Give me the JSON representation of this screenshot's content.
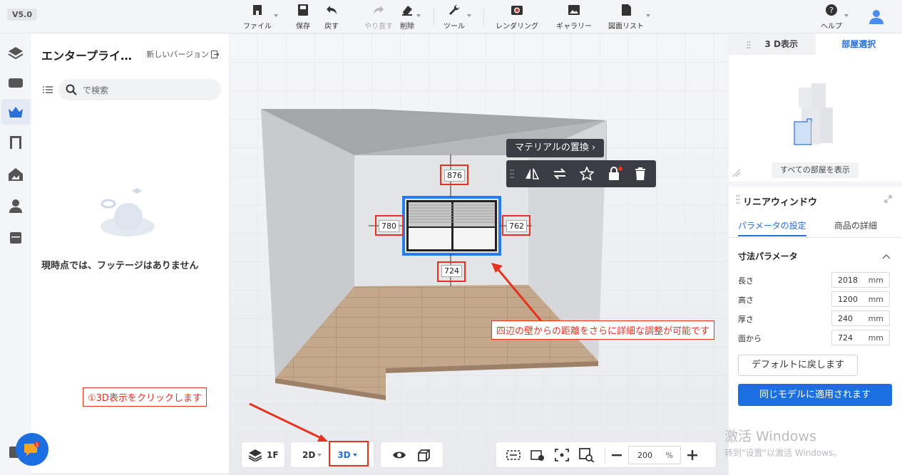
{
  "app": {
    "version": "V5.0"
  },
  "toolbar": {
    "file": "ファイル",
    "save": "保存",
    "undo": "戻す",
    "redo": "やり直す",
    "delete": "削除",
    "tools": "ツール",
    "rendering": "レンダリング",
    "gallery": "ギャラリー",
    "drawing_list": "図面リスト",
    "help": "ヘルプ"
  },
  "left_panel": {
    "title": "エンタープライ…",
    "new_version": "新しいバージョン",
    "search_placeholder": "で検索",
    "empty_message": "現時点では、フッテージはありません"
  },
  "viewport": {
    "dimensions": {
      "top": "876",
      "left": "780",
      "right": "762",
      "bottom": "724"
    },
    "context_menu_title": "マテリアルの置換",
    "callout_detail": "四辺の壁からの距離をさらに詳細な調整が可能です",
    "callout_step": "①3D表示をクリックします"
  },
  "bottom_bar": {
    "floor": "1F",
    "view_2d": "2D",
    "view_3d": "3D",
    "zoom_value": "200",
    "zoom_unit": "%"
  },
  "right_panel": {
    "tab_3d": "3 D表示",
    "tab_room": "部屋選択",
    "show_all_rooms": "すべての部屋を表示",
    "item_title": "リニアウィンドウ",
    "tab_params": "パラメータの設定",
    "tab_product": "商品の詳細",
    "section_dims": "寸法パラメータ",
    "params": [
      {
        "label": "長さ",
        "value": "2018",
        "unit": "mm"
      },
      {
        "label": "高さ",
        "value": "1200",
        "unit": "mm"
      },
      {
        "label": "厚さ",
        "value": "240",
        "unit": "mm"
      },
      {
        "label": "面から",
        "value": "724",
        "unit": "mm"
      }
    ],
    "reset_button": "デフォルトに戻します",
    "apply_button": "同じモデルに適用されます"
  },
  "watermark": {
    "line1": "激活 Windows",
    "line2": "转到\"设置\"以激活 Windows。"
  },
  "chat": {
    "badge": "1"
  },
  "colors": {
    "accent": "#1b6fe0",
    "highlight": "#e8321f"
  }
}
